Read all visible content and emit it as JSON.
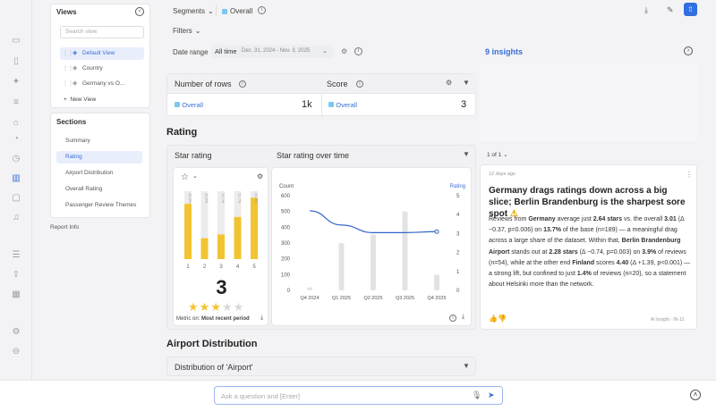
{
  "views": {
    "title": "Views",
    "search_placeholder": "Search view",
    "items": [
      {
        "label": "Default View"
      },
      {
        "label": "Country"
      },
      {
        "label": "Germany vs O..."
      }
    ],
    "new_view_label": "New View"
  },
  "sections": {
    "title": "Sections",
    "items": [
      "Summary",
      "Rating",
      "Airport Distribution",
      "Overall Rating",
      "Passenger Review Themes"
    ]
  },
  "report_info": "Report Info",
  "topbar": {
    "segments_label": "Segments",
    "overall_chip": "Overall",
    "filters_label": "Filters",
    "date_range_label": "Date range",
    "all_time": "All time",
    "date_span": "Dec. 31, 2024 - Nov. 3, 2025"
  },
  "metrics": {
    "rows_title": "Number of rows",
    "rows_segment": "Overall",
    "rows_value": "1k",
    "score_title": "Score",
    "score_segment": "Overall",
    "score_value": "3"
  },
  "rating": {
    "heading": "Rating",
    "card_title": "Star rating",
    "over_time_title": "Star rating over time",
    "big_score": "3",
    "stars_filled": 3,
    "stars_total": 5,
    "metric_on_label": "Metric on:",
    "metric_on_value": "Most recent period",
    "bar_categories": [
      "1",
      "2",
      "3",
      "4",
      "5"
    ],
    "bar_pct_labels": [
      "28.5%",
      "10.8%",
      "12.7%",
      "21.7%",
      "31.6%"
    ],
    "bar_values": [
      28.5,
      10.8,
      12.7,
      21.7,
      31.6
    ]
  },
  "chart_data": {
    "type": "line",
    "x": [
      "Q4 2024",
      "Q1 2025",
      "Q2 2025",
      "Q3 2025",
      "Q4 2025"
    ],
    "left_axis_label": "Count",
    "right_axis_label": "Rating",
    "left_ticks": [
      "0",
      "100",
      "200",
      "300",
      "400",
      "500",
      "600"
    ],
    "right_ticks": [
      "0",
      "1",
      "2",
      "3",
      "4",
      "5"
    ],
    "ylim_left": [
      0,
      600
    ],
    "ylim_right": [
      0,
      5
    ],
    "bars_count": [
      20,
      300,
      355,
      500,
      100
    ],
    "line_rating": [
      4.2,
      3.45,
      3.05,
      3.05,
      3.1
    ],
    "colors": {
      "bars": "#e3e3e6",
      "line": "#2f63c9"
    }
  },
  "airport": {
    "heading": "Airport Distribution",
    "card_title": "Distribution of 'Airport'"
  },
  "insights": {
    "count_label": "9 insights",
    "pager": "1 of 1",
    "age": "12 days ago",
    "headline": "Germany drags ratings down across a big slice; Berlin Brandenburg is the sharpest sore spot",
    "body": [
      {
        "t": "Reviews from "
      },
      {
        "b": "Germany"
      },
      {
        "t": " average just "
      },
      {
        "b": "2.64 stars"
      },
      {
        "t": " vs. the overall "
      },
      {
        "b": "3.01"
      },
      {
        "t": " (Δ −0.37, p=0.006) on "
      },
      {
        "b": "13.7%"
      },
      {
        "t": " of the base (n=189) — a meaningful drag across a large share of the dataset. Within that, "
      },
      {
        "b": "Berlin Brandenburg Airport"
      },
      {
        "t": " stands out at "
      },
      {
        "b": "2.28 stars"
      },
      {
        "t": " (Δ −0.74, p=0.003) on "
      },
      {
        "b": "3.9%"
      },
      {
        "t": " of reviews (n=54), while at the other end "
      },
      {
        "b": "Finland"
      },
      {
        "t": " scores "
      },
      {
        "b": "4.40"
      },
      {
        "t": " (Δ +1.39, p<0.001) — a strong lift, but confined to just "
      },
      {
        "b": "1.4%"
      },
      {
        "t": " of reviews (n=20), so a statement about Helsinki more than the network."
      }
    ],
    "footer_tag": "AI Insight · IN-12"
  },
  "ask": {
    "placeholder": "Ask a question and [Enter]"
  },
  "colors": {
    "accent": "#3b6fd8",
    "bar_yellow": "#f2c431",
    "bar_bg": "#ececee",
    "star": "#f2c431"
  }
}
